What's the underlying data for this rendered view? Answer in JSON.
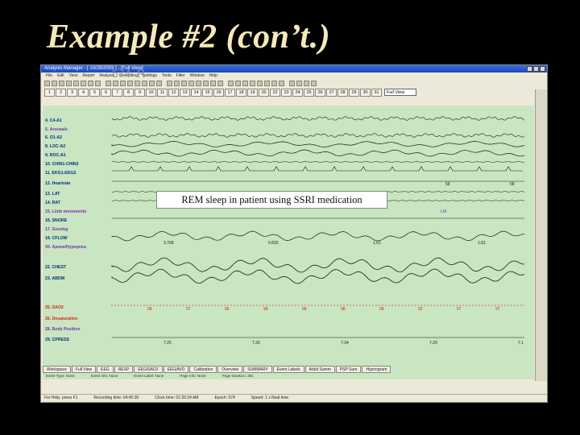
{
  "slide": {
    "title": "Example #2 (con’t.)",
    "caption": "REM sleep in patient using SSRI medication"
  },
  "window": {
    "title": "Analysis Manager - [ 10/29/2003 ] - [Full View]"
  },
  "menu": [
    "File",
    "Edit",
    "View",
    "Report",
    "Analysis",
    "Recording",
    "Settings",
    "Tools",
    "Filter",
    "Window",
    "Help"
  ],
  "epoch_buttons": [
    "1",
    "2",
    "3",
    "4",
    "5",
    "6",
    "7",
    "8",
    "9",
    "10",
    "11",
    "12",
    "13",
    "14",
    "15",
    "16",
    "17",
    "18",
    "19",
    "20",
    "22",
    "23",
    "24",
    "25",
    "26",
    "27",
    "28",
    "29",
    "30",
    "31"
  ],
  "view_select": "Full View",
  "epoch_number": "574",
  "stage_label": "R",
  "channels": [
    {
      "label": "4. C4-A1",
      "color": "navy"
    },
    {
      "label": "5. Arousals",
      "color": "purple"
    },
    {
      "label": "6. O1-A2",
      "color": "navy"
    },
    {
      "label": "8. LOC-A2",
      "color": "navy"
    },
    {
      "label": "9. ROC-A1",
      "color": "navy"
    },
    {
      "label": "10. CHIN1-CHIN2",
      "color": "navy"
    },
    {
      "label": "11. EKG1-EKG2",
      "color": "navy"
    },
    {
      "label": "12. Heartrate",
      "color": "navy"
    },
    {
      "label": "13. LAT",
      "color": "navy"
    },
    {
      "label": "14. RAT",
      "color": "navy"
    },
    {
      "label": "15. Limb movements",
      "color": "purple"
    },
    {
      "label": "16. SNORE",
      "color": "navy"
    },
    {
      "label": "17. Snoring",
      "color": "purple"
    },
    {
      "label": "19. CFLOW",
      "color": "navy"
    },
    {
      "label": "20. Apnea/Hypopnea",
      "color": "purple"
    },
    {
      "label": "22. CHEST",
      "color": "navy"
    },
    {
      "label": "23. ABDM",
      "color": "navy"
    },
    {
      "label": "25. SAO2",
      "color": "red"
    },
    {
      "label": "26. Desaturation",
      "color": "red"
    },
    {
      "label": "28. Body Position",
      "color": "purple"
    },
    {
      "label": "29. CPRESS",
      "color": "navy"
    }
  ],
  "sao2_values": [
    "98",
    "97",
    "95",
    "98",
    "98",
    "98",
    "98",
    "92",
    "97",
    "97"
  ],
  "cpress_values": [
    "7.25",
    "7.36",
    "7.34",
    "7.29",
    "7.1"
  ],
  "cflow_values": [
    "3.768",
    "0.825",
    "1.61",
    "1.81"
  ],
  "heartrate_values": [
    "58",
    "58"
  ],
  "limb_badge": "LM",
  "tabs": [
    "Workspace",
    "Full View",
    "EEG",
    "RESP",
    "EEG/SAO2",
    "EEG/AVD",
    "Calibration",
    "Overview",
    "SUMMARY",
    "Event Labels",
    "Adult Summ",
    "PSP Sum",
    "Hypnogram"
  ],
  "event_row": [
    "Event Type: None",
    "Event Info: None",
    "Event Label: None",
    "Page Info: None",
    "Page Duration: 30s"
  ],
  "statusbar": {
    "left": "For Help, press F1",
    "recording_time": "Recording time: 04:45:30",
    "clock": "Clock time: 01:25:34 AM",
    "epoch": "Epoch: 574",
    "speed": "Speed: 1 x Real time"
  },
  "colors": {
    "background": "#000000",
    "title": "#f6e9b8",
    "plot_background": "#c9e5c1",
    "trace": "#1a1a1a",
    "sao2_dots": "#cc2a1a"
  }
}
